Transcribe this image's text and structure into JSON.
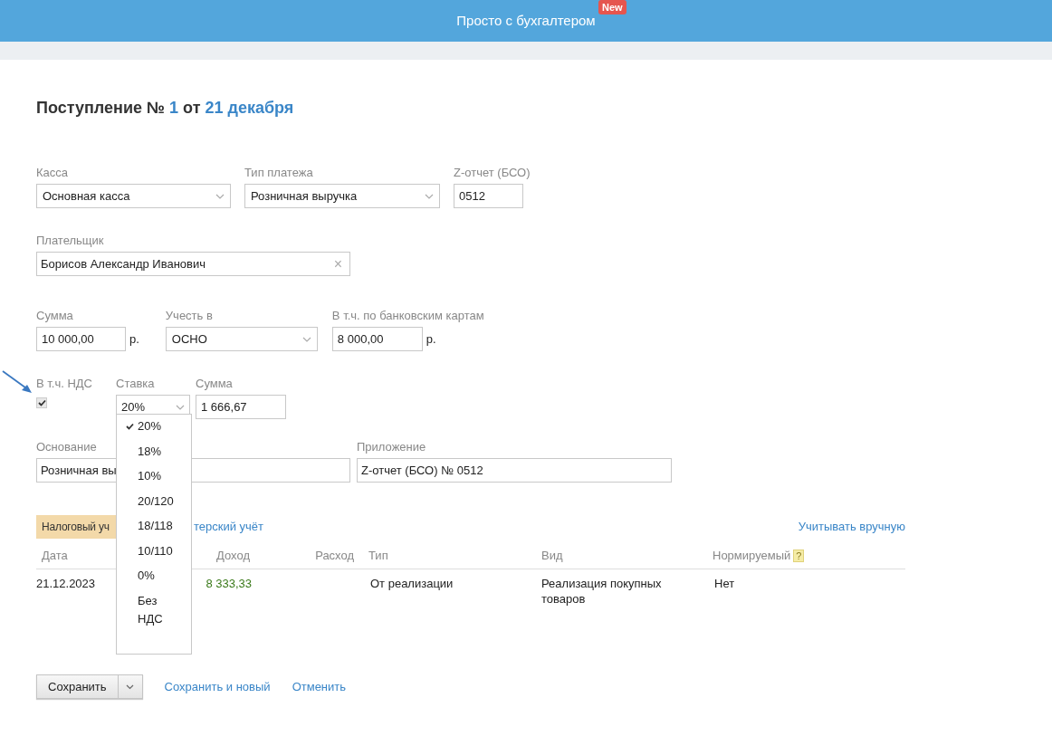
{
  "header": {
    "title": "Просто с бухгалтером",
    "badge": "New"
  },
  "heading": {
    "prefix": "Поступление №",
    "number": "1",
    "middle": "от",
    "date": "21 декабря"
  },
  "field_rows": [
    {
      "fields": [
        {
          "kind": "select",
          "label": "Касса",
          "value": "Основная касса"
        },
        {
          "kind": "select",
          "label": "Тип платежа",
          "value": "Розничная выручка"
        },
        {
          "kind": "text",
          "label": "Z-отчет (БСО)",
          "value": "0512"
        }
      ]
    },
    {
      "fields": [
        {
          "kind": "clearable",
          "label": "Плательщик",
          "value": "Борисов Александр Иванович",
          "clear": "×"
        }
      ]
    },
    {
      "fields": [
        {
          "kind": "text",
          "label": "Сумма",
          "value": "10 000,00",
          "suffix": "р."
        },
        {
          "kind": "select",
          "label": "Учесть в",
          "value": "ОСНО"
        },
        {
          "kind": "text",
          "label": "В т.ч. по банковским картам",
          "value": "8 000,00",
          "suffix": "р."
        }
      ]
    }
  ],
  "vat": {
    "label": "В т.ч. НДС",
    "checked": true,
    "rate_label": "Ставка",
    "rate_value": "20%",
    "sum_label": "Сумма",
    "sum_value": "1 666,67",
    "options": [
      {
        "label": "20%",
        "selected": true
      },
      {
        "label": "18%",
        "selected": false
      },
      {
        "label": "10%",
        "selected": false
      },
      {
        "label": "20/120",
        "selected": false
      },
      {
        "label": "18/118",
        "selected": false
      },
      {
        "label": "10/110",
        "selected": false
      },
      {
        "label": "0%",
        "selected": false
      },
      {
        "label": "Без НДС",
        "selected": false
      }
    ]
  },
  "basis": {
    "label": "Основание",
    "value": "Розничная вы"
  },
  "attachment": {
    "label": "Приложение",
    "value": "Z-отчет (БСО) № 0512"
  },
  "tabs": [
    {
      "label": "Налоговый уч",
      "selected": true
    },
    {
      "label": "терский учёт",
      "selected": false
    }
  ],
  "manual_link": "Учитывать вручную",
  "table": {
    "columns": [
      {
        "label": "Дата"
      },
      {
        "label": "Доход"
      },
      {
        "label": "Расход"
      },
      {
        "label": "Тип"
      },
      {
        "label": "Вид"
      },
      {
        "label": "Нормируемый",
        "help": "?"
      }
    ],
    "rows": [
      {
        "date": "21.12.2023",
        "income": "8 333,33",
        "type": "От реализации",
        "kind": "Реализация покупных товаров",
        "normed": "Нет"
      }
    ]
  },
  "actions": {
    "save": "Сохранить",
    "save_new": "Сохранить и новый",
    "cancel": "Отменить"
  }
}
